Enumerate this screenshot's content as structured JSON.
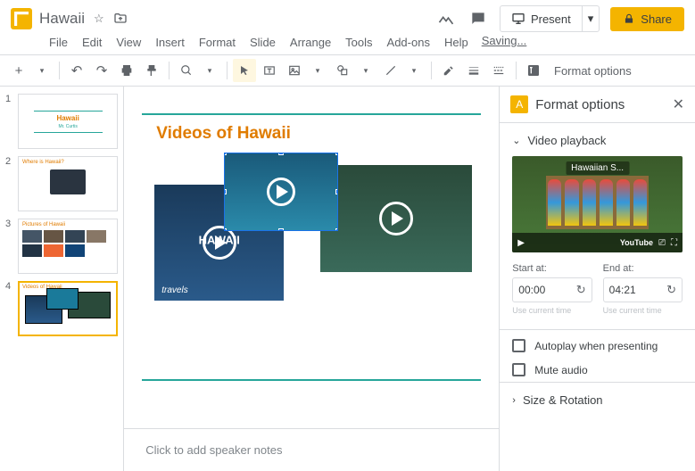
{
  "doc": {
    "title": "Hawaii",
    "saving": "Saving..."
  },
  "menu": [
    "File",
    "Edit",
    "View",
    "Insert",
    "Format",
    "Slide",
    "Arrange",
    "Tools",
    "Add-ons",
    "Help"
  ],
  "header_actions": {
    "present": "Present",
    "share": "Share"
  },
  "toolbar": {
    "format_options": "Format options"
  },
  "thumbs": [
    {
      "num": "1",
      "title": "Hawaii",
      "subtitle": "Mr. Curtis"
    },
    {
      "num": "2",
      "title": "Where is Hawaii?"
    },
    {
      "num": "3",
      "title": "Pictures of Hawaii"
    },
    {
      "num": "4",
      "title": "Videos of Hawaii"
    }
  ],
  "slide": {
    "title": "Videos of Hawaii",
    "video1_overlay": "HAWAII",
    "video1_sub": "travels"
  },
  "notes_placeholder": "Click to add speaker notes",
  "panel": {
    "title": "Format options",
    "section1": "Video playback",
    "preview_title": "Hawaiian S...",
    "youtube": "YouTube",
    "start_label": "Start at:",
    "start_value": "00:00",
    "end_label": "End at:",
    "end_value": "04:21",
    "use_current": "Use current time",
    "autoplay": "Autoplay when presenting",
    "mute": "Mute audio",
    "section2": "Size & Rotation"
  }
}
